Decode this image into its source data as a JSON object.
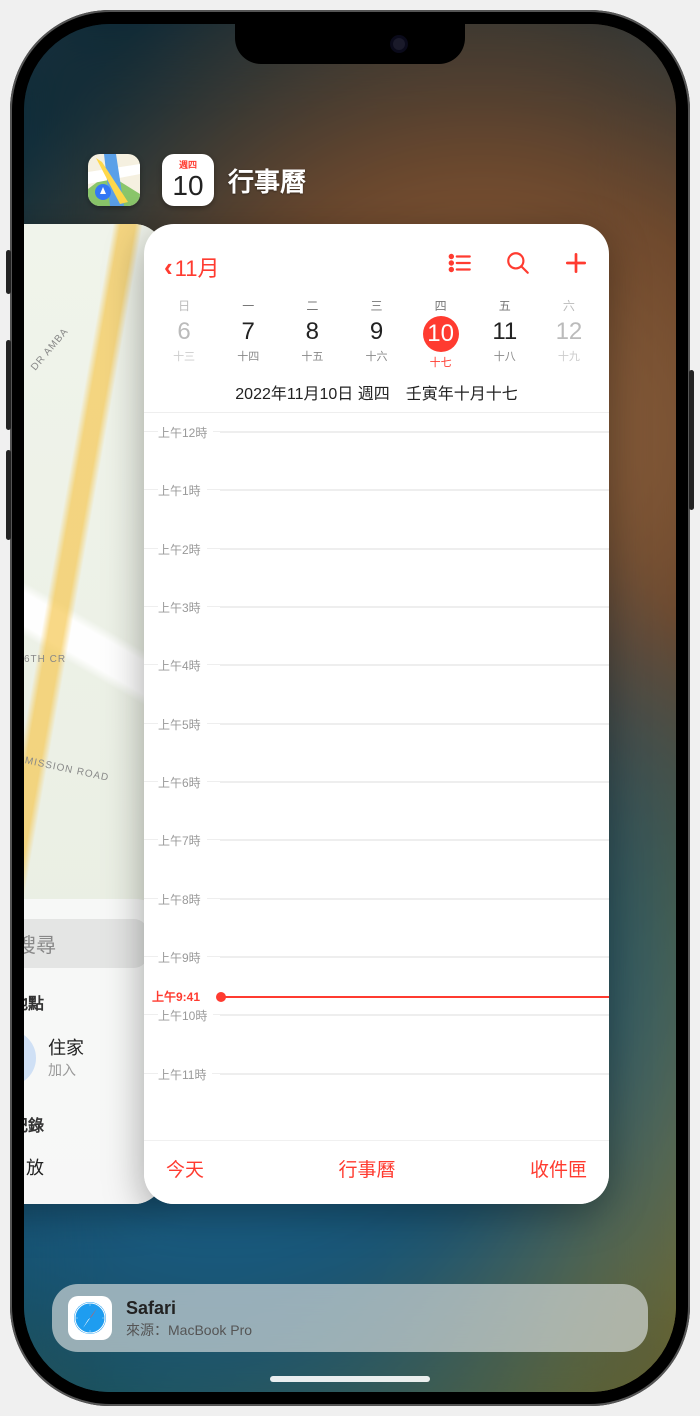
{
  "switcher": {
    "maps_icon": "maps-icon",
    "calendar_icon": {
      "weekday": "週四",
      "date": "10"
    },
    "front_app_title": "行事曆"
  },
  "maps": {
    "road_labels": [
      "DR AMBA",
      "6TH CR",
      "MISSION ROAD"
    ],
    "search_placeholder": "搜尋",
    "favorites_header": "喜好地點",
    "home_label": "住家",
    "home_sublabel": "加入",
    "history_header": "搜尋記錄",
    "pin_label": "放"
  },
  "calendar": {
    "back_label": "11月",
    "weekdays": [
      "日",
      "一",
      "二",
      "三",
      "四",
      "五",
      "六"
    ],
    "dates": [
      {
        "d": "6",
        "lunar": "十三",
        "dim": true
      },
      {
        "d": "7",
        "lunar": "十四"
      },
      {
        "d": "8",
        "lunar": "十五"
      },
      {
        "d": "9",
        "lunar": "十六"
      },
      {
        "d": "10",
        "lunar": "十七",
        "today": true
      },
      {
        "d": "11",
        "lunar": "十八"
      },
      {
        "d": "12",
        "lunar": "十九",
        "dim": true
      }
    ],
    "subtitle": "2022年11月10日 週四　壬寅年十月十七",
    "hours": [
      "上午12時",
      "上午1時",
      "上午2時",
      "上午3時",
      "上午4時",
      "上午5時",
      "上午6時",
      "上午7時",
      "上午8時",
      "上午9時",
      "上午10時",
      "上午11時"
    ],
    "now_label": "上午9:41",
    "now_fraction": 0.806,
    "tabs": {
      "today": "今天",
      "calendars": "行事曆",
      "inbox": "收件匣"
    }
  },
  "handoff": {
    "app": "Safari",
    "source": "來源：MacBook Pro"
  }
}
